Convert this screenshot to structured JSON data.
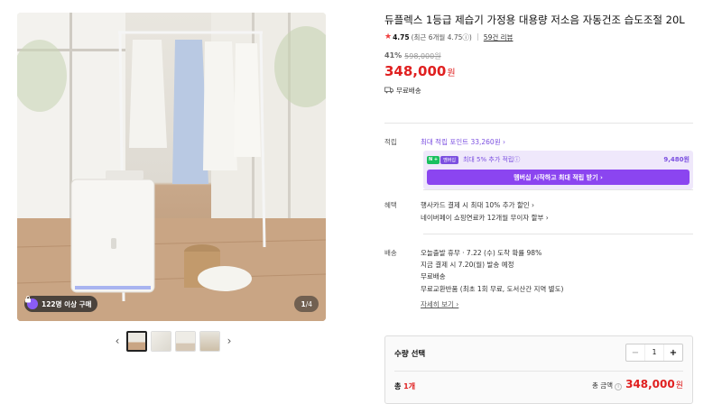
{
  "gallery": {
    "buyers_badge": "122명 이상 구매",
    "counter_current": "1",
    "counter_total": "/4",
    "prev_label": "‹",
    "next_label": "›"
  },
  "product": {
    "title": "듀플렉스 1등급 제습기 가정용 대용량 저소음 자동건조 습도조절 20L",
    "rating": "4.75",
    "rating_detail": "(최근 6개월 4.75ⓘ)",
    "review_link": "59건 리뷰",
    "discount": "41%",
    "original_price": "598,000원",
    "price": "348,000",
    "price_unit": "원",
    "shipping": "무료배송"
  },
  "points": {
    "label": "적립",
    "max_points": "최대 적립 포인트 33,260원 ›",
    "np_chip": "N +",
    "np_chip2": "멤버십",
    "np_text": "최대 5% 추가 적립ⓘ",
    "np_value": "9,480원",
    "np_button": "멤버십 시작하고 최대 적립 받기 ›"
  },
  "benefits": {
    "label": "혜택",
    "items": [
      "행사카드 결제 시 최대 10% 추가 할인 ›",
      "네이버페이 쇼핑연료카 12개월 무이자 할부 ›"
    ]
  },
  "delivery": {
    "label": "배송",
    "line1": "오늘출발 휴무 · 7.22 (수) 도착 확률 98%",
    "line2": "지금 결제 시 7.20(월) 발송 예정",
    "line3": "무료배송",
    "line4": "무료교환반품 (최초 1회 무료, 도서산간 지역 별도)",
    "more": "자세히 보기 ›"
  },
  "quantity": {
    "label": "수량 선택",
    "minus": "−",
    "value": "1",
    "plus": "+",
    "total_prefix": "총 ",
    "total_count": "1개",
    "total_label": "총 금액",
    "total_amount": "348,000",
    "total_unit": "원"
  }
}
